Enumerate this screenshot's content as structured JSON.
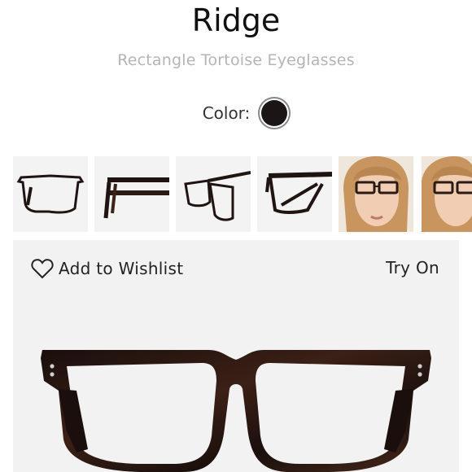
{
  "product": {
    "name": "Ridge",
    "subtitle": "Rectangle Tortoise Eyeglasses",
    "color_label": "Color:",
    "selected_color": "#1c1516"
  },
  "thumbnails": [
    {
      "view": "front",
      "icon": "glasses-front-view"
    },
    {
      "view": "side",
      "icon": "glasses-side-view"
    },
    {
      "view": "angle",
      "icon": "glasses-angle-view"
    },
    {
      "view": "three-quarter",
      "icon": "glasses-three-quarter-view"
    },
    {
      "view": "model-1",
      "icon": "model-photo"
    },
    {
      "view": "model-2",
      "icon": "model-photo"
    }
  ],
  "actions": {
    "wishlist_label": "Add to Wishlist",
    "wishlist_icon": "heart-outline-icon",
    "try_on_label": "Try On"
  },
  "colors": {
    "frame": "#1f1412",
    "tortoise_accent": "#4a2a1c",
    "panel_bg": "#f2f2f2",
    "subtitle": "#b5b5b5"
  }
}
